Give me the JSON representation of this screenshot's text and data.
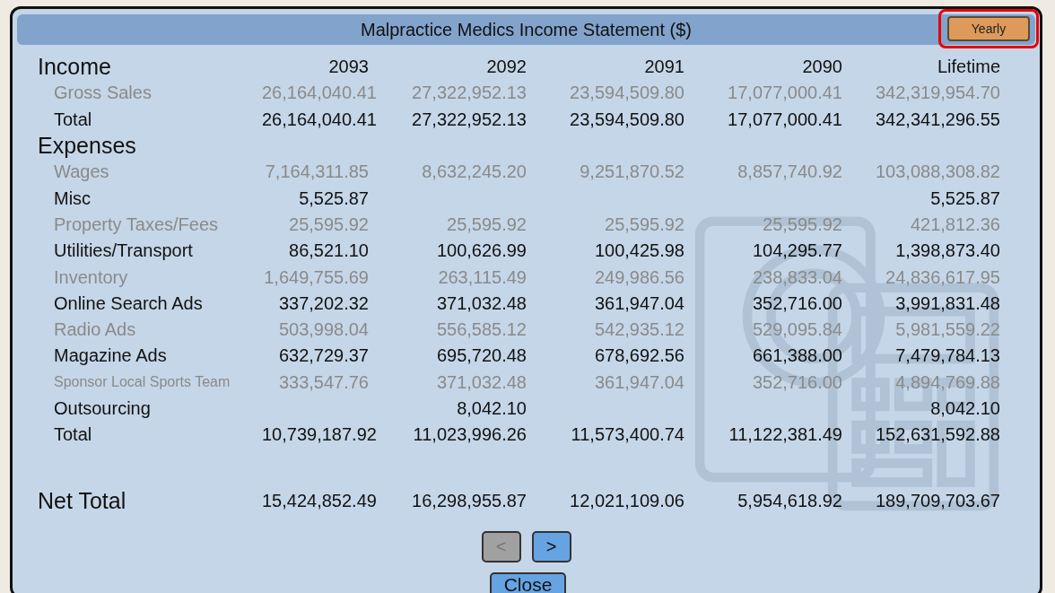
{
  "window": {
    "title": "Malpractice Medics Income Statement ($)"
  },
  "period_button": {
    "label": "Yearly",
    "highlighted": true
  },
  "columns": [
    "2093",
    "2092",
    "2091",
    "2090",
    "Lifetime"
  ],
  "rows": [
    {
      "kind": "section",
      "label": "Income",
      "muted": false,
      "compact": false
    },
    {
      "kind": "line",
      "label": "Gross Sales",
      "muted": true,
      "compact": false,
      "values": {
        "col_1": "26,164,040.41",
        "col_2": "27,322,952.13",
        "col_3": "23,594,509.80",
        "col_4": "17,077,000.41",
        "col_5": "342,319,954.70"
      }
    },
    {
      "kind": "line",
      "label": "Total",
      "muted": false,
      "compact": false,
      "values": {
        "col_1": "26,164,040.41",
        "col_2": "27,322,952.13",
        "col_3": "23,594,509.80",
        "col_4": "17,077,000.41",
        "col_5": "342,341,296.55"
      }
    },
    {
      "kind": "section",
      "label": "Expenses",
      "muted": false,
      "compact": false
    },
    {
      "kind": "line",
      "label": "Wages",
      "muted": true,
      "compact": false,
      "values": {
        "col_1": "7,164,311.85",
        "col_2": "8,632,245.20",
        "col_3": "9,251,870.52",
        "col_4": "8,857,740.92",
        "col_5": "103,088,308.82"
      }
    },
    {
      "kind": "line",
      "label": "Misc",
      "muted": false,
      "compact": false,
      "values": {
        "col_1": "5,525.87",
        "col_5": "5,525.87"
      }
    },
    {
      "kind": "line",
      "label": "Property Taxes/Fees",
      "muted": true,
      "compact": false,
      "values": {
        "col_1": "25,595.92",
        "col_2": "25,595.92",
        "col_3": "25,595.92",
        "col_4": "25,595.92",
        "col_5": "421,812.36"
      }
    },
    {
      "kind": "line",
      "label": "Utilities/Transport",
      "muted": false,
      "compact": false,
      "values": {
        "col_1": "86,521.10",
        "col_2": "100,626.99",
        "col_3": "100,425.98",
        "col_4": "104,295.77",
        "col_5": "1,398,873.40"
      }
    },
    {
      "kind": "line",
      "label": "Inventory",
      "muted": true,
      "compact": false,
      "values": {
        "col_1": "1,649,755.69",
        "col_2": "263,115.49",
        "col_3": "249,986.56",
        "col_4": "238,833.04",
        "col_5": "24,836,617.95"
      }
    },
    {
      "kind": "line",
      "label": "Online Search Ads",
      "muted": false,
      "compact": false,
      "values": {
        "col_1": "337,202.32",
        "col_2": "371,032.48",
        "col_3": "361,947.04",
        "col_4": "352,716.00",
        "col_5": "3,991,831.48"
      }
    },
    {
      "kind": "line",
      "label": "Radio Ads",
      "muted": true,
      "compact": false,
      "values": {
        "col_1": "503,998.04",
        "col_2": "556,585.12",
        "col_3": "542,935.12",
        "col_4": "529,095.84",
        "col_5": "5,981,559.22"
      }
    },
    {
      "kind": "line",
      "label": "Magazine Ads",
      "muted": false,
      "compact": false,
      "values": {
        "col_1": "632,729.37",
        "col_2": "695,720.48",
        "col_3": "678,692.56",
        "col_4": "661,388.00",
        "col_5": "7,479,784.13"
      }
    },
    {
      "kind": "line",
      "label": "Sponsor Local Sports Team",
      "muted": true,
      "compact": true,
      "values": {
        "col_1": "333,547.76",
        "col_2": "371,032.48",
        "col_3": "361,947.04",
        "col_4": "352,716.00",
        "col_5": "4,894,769.88"
      }
    },
    {
      "kind": "line",
      "label": "Outsourcing",
      "muted": false,
      "compact": false,
      "values": {
        "col_2": "8,042.10",
        "col_5": "8,042.10"
      }
    },
    {
      "kind": "line",
      "label": "Total",
      "muted": false,
      "compact": false,
      "values": {
        "col_1": "10,739,187.92",
        "col_2": "11,023,996.26",
        "col_3": "11,573,400.74",
        "col_4": "11,122,381.49",
        "col_5": "152,631,592.88"
      }
    },
    {
      "kind": "net",
      "label": "Net Total",
      "muted": false,
      "compact": false,
      "values": {
        "col_1": "15,424,852.49",
        "col_2": "16,298,955.87",
        "col_3": "12,021,109.06",
        "col_4": "5,954,618.92",
        "col_5": "189,709,703.67"
      }
    }
  ],
  "nav_buttons": [
    {
      "label": "<",
      "disabled": true
    },
    {
      "label": ">",
      "disabled": false
    }
  ],
  "close_button": {
    "label": "Close"
  }
}
